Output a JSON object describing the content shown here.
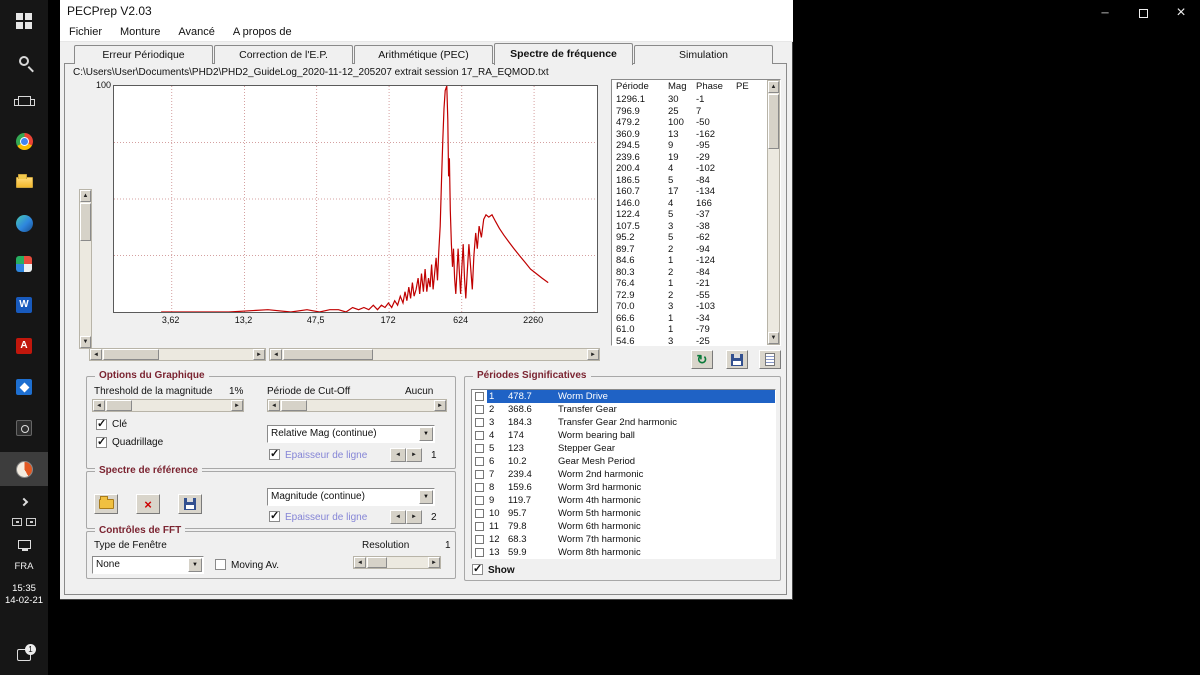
{
  "taskbar": {
    "word_glyph": "W",
    "acrobat_glyph": "A",
    "language": "FRA",
    "time": "15:35",
    "date": "14-02-21",
    "notification_badge": "1"
  },
  "window": {
    "title": "PECPrep V2.03",
    "menu": [
      "Fichier",
      "Monture",
      "Avancé",
      "A propos de"
    ],
    "tabs": [
      {
        "label": "Erreur Périodique",
        "selected": false
      },
      {
        "label": "Correction de l'E.P.",
        "selected": false
      },
      {
        "label": "Arithmétique (PEC)",
        "selected": false
      },
      {
        "label": "Spectre de fréquence",
        "selected": true
      },
      {
        "label": "Simulation",
        "selected": false
      }
    ],
    "file_path": "C:\\Users\\User\\Documents\\PHD2\\PHD2_GuideLog_2020-11-12_205207 extrait session 17_RA_EQMOD.txt"
  },
  "chart_data": {
    "type": "line",
    "x_scale": "log",
    "x_range": [
      1.3,
      6900
    ],
    "y_range": [
      0,
      100
    ],
    "y_top_label": "100",
    "grid": true,
    "line_color": "#c00000",
    "x_ticks": [
      {
        "value": 3.62,
        "label": "3,62"
      },
      {
        "value": 13.2,
        "label": "13,2"
      },
      {
        "value": 47.5,
        "label": "47,5"
      },
      {
        "value": 172,
        "label": "172"
      },
      {
        "value": 624,
        "label": "624"
      },
      {
        "value": 2260,
        "label": "2260"
      }
    ],
    "y_gridlines": [
      25,
      50,
      75
    ],
    "series": [
      {
        "name": "spectre",
        "points": [
          [
            3,
            0
          ],
          [
            10,
            0
          ],
          [
            20,
            1
          ],
          [
            30,
            0
          ],
          [
            40,
            1
          ],
          [
            50,
            0
          ],
          [
            60,
            1
          ],
          [
            70,
            1
          ],
          [
            80,
            0
          ],
          [
            90,
            2
          ],
          [
            100,
            1
          ],
          [
            110,
            2
          ],
          [
            120,
            1
          ],
          [
            130,
            3
          ],
          [
            140,
            1
          ],
          [
            150,
            3
          ],
          [
            160,
            2
          ],
          [
            170,
            4
          ],
          [
            180,
            2
          ],
          [
            190,
            5
          ],
          [
            200,
            3
          ],
          [
            210,
            7
          ],
          [
            220,
            4
          ],
          [
            228,
            9
          ],
          [
            236,
            5
          ],
          [
            244,
            11
          ],
          [
            252,
            6
          ],
          [
            260,
            13
          ],
          [
            268,
            7
          ],
          [
            278,
            10
          ],
          [
            288,
            15
          ],
          [
            296,
            8
          ],
          [
            306,
            17
          ],
          [
            316,
            9
          ],
          [
            326,
            19
          ],
          [
            336,
            9
          ],
          [
            346,
            15
          ],
          [
            356,
            11
          ],
          [
            366,
            21
          ],
          [
            376,
            10
          ],
          [
            386,
            17
          ],
          [
            396,
            24
          ],
          [
            406,
            14
          ],
          [
            416,
            27
          ],
          [
            426,
            38
          ],
          [
            436,
            58
          ],
          [
            446,
            76
          ],
          [
            456,
            90
          ],
          [
            466,
            98
          ],
          [
            479,
            100
          ],
          [
            488,
            85
          ],
          [
            495,
            60
          ],
          [
            502,
            68
          ],
          [
            510,
            45
          ],
          [
            520,
            30
          ],
          [
            530,
            20
          ],
          [
            540,
            28
          ],
          [
            550,
            15
          ],
          [
            562,
            8
          ],
          [
            574,
            18
          ],
          [
            586,
            28
          ],
          [
            598,
            18
          ],
          [
            612,
            8
          ],
          [
            626,
            20
          ],
          [
            641,
            30
          ],
          [
            656,
            15
          ],
          [
            672,
            6
          ],
          [
            690,
            18
          ],
          [
            710,
            30
          ],
          [
            731,
            20
          ],
          [
            753,
            10
          ],
          [
            776,
            25
          ],
          [
            800,
            35
          ],
          [
            824,
            28
          ],
          [
            850,
            38
          ],
          [
            886,
            33
          ],
          [
            923,
            41
          ],
          [
            961,
            43
          ],
          [
            1010,
            42
          ],
          [
            1070,
            43
          ],
          [
            1140,
            40
          ],
          [
            1220,
            37
          ],
          [
            1320,
            34
          ],
          [
            1440,
            31
          ],
          [
            1580,
            28
          ],
          [
            1740,
            25
          ],
          [
            1920,
            22
          ],
          [
            2120,
            19
          ],
          [
            2350,
            17
          ],
          [
            2600,
            15
          ],
          [
            2900,
            13
          ]
        ]
      }
    ]
  },
  "fft_table": {
    "headers": [
      "Période",
      "Mag",
      "Phase",
      "PE"
    ],
    "rows": [
      [
        "1296.1",
        "30",
        "-1",
        ""
      ],
      [
        "796.9",
        "25",
        "7",
        ""
      ],
      [
        "479.2",
        "100",
        "-50",
        ""
      ],
      [
        "360.9",
        "13",
        "-162",
        ""
      ],
      [
        "294.5",
        "9",
        "-95",
        ""
      ],
      [
        "239.6",
        "19",
        "-29",
        ""
      ],
      [
        "200.4",
        "4",
        "-102",
        ""
      ],
      [
        "186.5",
        "5",
        "-84",
        ""
      ],
      [
        "160.7",
        "17",
        "-134",
        ""
      ],
      [
        "146.0",
        "4",
        "166",
        ""
      ],
      [
        "122.4",
        "5",
        "-37",
        ""
      ],
      [
        "107.5",
        "3",
        "-38",
        ""
      ],
      [
        "95.2",
        "5",
        "-62",
        ""
      ],
      [
        "89.7",
        "2",
        "-94",
        ""
      ],
      [
        "84.6",
        "1",
        "-124",
        ""
      ],
      [
        "80.3",
        "2",
        "-84",
        ""
      ],
      [
        "76.4",
        "1",
        "-21",
        ""
      ],
      [
        "72.9",
        "2",
        "-55",
        ""
      ],
      [
        "70.0",
        "3",
        "-103",
        ""
      ],
      [
        "66.6",
        "1",
        "-34",
        ""
      ],
      [
        "61.0",
        "1",
        "-79",
        ""
      ],
      [
        "54.6",
        "3",
        "-25",
        ""
      ]
    ]
  },
  "graph_options": {
    "title": "Options du Graphique",
    "threshold_label": "Threshold de la magnitude",
    "threshold_value": "1%",
    "cutoff_label": "Période de Cut-Off",
    "cutoff_value": "Aucun",
    "key_label": "Clé",
    "key_checked": true,
    "grid_label": "Quadrillage",
    "grid_checked": true,
    "mag_mode": "Relative Mag (continue)",
    "line_width_label": "Epaisseur de ligne",
    "line_width_checked": true,
    "line_width_value": "1"
  },
  "reference_spectrum": {
    "title": "Spectre de référence",
    "mag_mode": "Magnitude (continue)",
    "line_width_label": "Epaisseur de ligne",
    "line_width_checked": true,
    "line_width_value": "2"
  },
  "fft_controls": {
    "title": "Contrôles de FFT",
    "window_type_label": "Type de Fenêtre",
    "window_type": "None",
    "moving_av_label": "Moving Av.",
    "moving_av_checked": false,
    "resolution_label": "Resolution",
    "resolution_value": "1"
  },
  "significant_periods": {
    "title": "Périodes Significatives",
    "show_label": "Show",
    "show_checked": true,
    "rows": [
      {
        "num": "1",
        "period": "478.7",
        "name": "Worm Drive",
        "selected": true
      },
      {
        "num": "2",
        "period": "368.6",
        "name": "Transfer Gear"
      },
      {
        "num": "3",
        "period": "184.3",
        "name": "Transfer Gear 2nd harmonic"
      },
      {
        "num": "4",
        "period": "174",
        "name": "Worm bearing ball"
      },
      {
        "num": "5",
        "period": "123",
        "name": "Stepper Gear"
      },
      {
        "num": "6",
        "period": "10.2",
        "name": "Gear Mesh Period"
      },
      {
        "num": "7",
        "period": "239.4",
        "name": "Worm 2nd harmonic"
      },
      {
        "num": "8",
        "period": "159.6",
        "name": "Worm 3rd harmonic"
      },
      {
        "num": "9",
        "period": "119.7",
        "name": "Worm 4th harmonic"
      },
      {
        "num": "10",
        "period": "95.7",
        "name": "Worm 5th harmonic"
      },
      {
        "num": "11",
        "period": "79.8",
        "name": "Worm 6th harmonic"
      },
      {
        "num": "12",
        "period": "68.3",
        "name": "Worm 7th harmonic"
      },
      {
        "num": "13",
        "period": "59.9",
        "name": "Worm 8th harmonic"
      }
    ]
  },
  "icons": {
    "refresh": "↻",
    "clear": "×",
    "dropdown_arrow": "▼"
  }
}
